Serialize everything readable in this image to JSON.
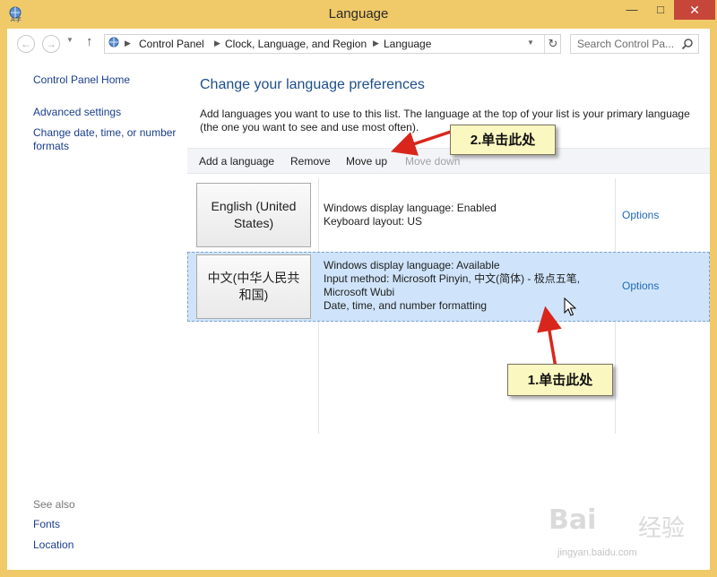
{
  "window": {
    "title": "Language"
  },
  "navbar": {
    "breadcrumb": [
      "Control Panel",
      "Clock, Language, and Region",
      "Language"
    ],
    "search_placeholder": "Search Control Pa..."
  },
  "sidebar": {
    "links": [
      "Control Panel Home",
      "Advanced settings",
      "Change date, time, or number formats"
    ],
    "see_also_label": "See also",
    "see_also_links": [
      "Fonts",
      "Location"
    ]
  },
  "main": {
    "heading": "Change your language preferences",
    "description": "Add languages you want to use to this list. The language at the top of your list is your primary language (the one you want to see and use most often).",
    "toolbar": {
      "add": "Add a language",
      "remove": "Remove",
      "move_up": "Move up",
      "move_down": "Move down"
    },
    "languages": [
      {
        "name": "English (United States)",
        "info": [
          "Windows display language: Enabled",
          "Keyboard layout: US"
        ],
        "options": "Options"
      },
      {
        "name": "中文(中华人民共和国)",
        "info": [
          "Windows display language: Available",
          "Input method: Microsoft Pinyin, 中文(简体) - 极点五笔,",
          "Microsoft Wubi",
          "Date, time, and number formatting"
        ],
        "options": "Options"
      }
    ]
  },
  "callouts": {
    "step1": "1.单击此处",
    "step2": "2.单击此处"
  },
  "watermark": {
    "brand": "Bai",
    "brand_cn": "经验",
    "url": "jingyan.baidu.com"
  },
  "colors": {
    "title_bar": "#f0ca69",
    "close_button": "#c7463a",
    "link": "#1a3e8c",
    "selected_row": "#cfe4fa",
    "callout_bg": "#fbf7c0",
    "arrow": "#d9261c"
  }
}
